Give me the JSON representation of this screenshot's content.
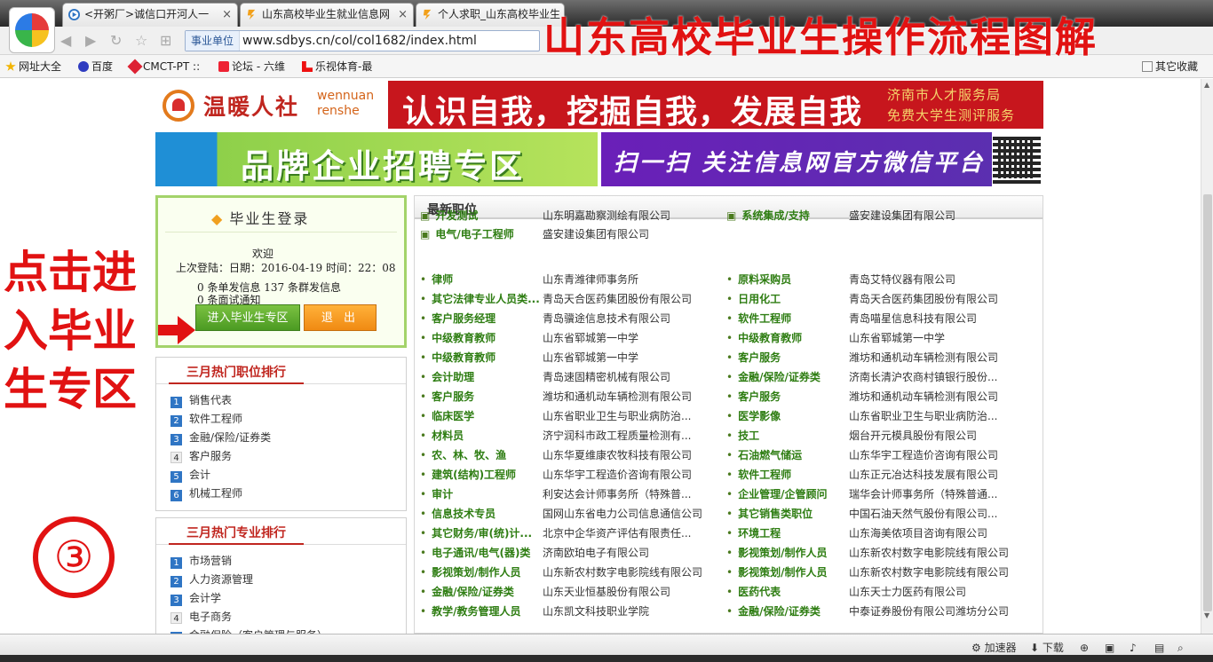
{
  "browser": {
    "tabs": [
      {
        "label": "<开粥厂>诚信口开河人一",
        "close": "×"
      },
      {
        "label": "山东高校毕业生就业信息网",
        "close": "×"
      },
      {
        "label": "个人求职_山东高校毕业生",
        "close": "×"
      }
    ],
    "address": {
      "chip": "事业单位",
      "url": "www.sdbys.cn/col/col1682/index.html"
    },
    "search_partial": "百度",
    "bookmarks": [
      "网址大全",
      "百度",
      "CMCT-PT ::",
      "论坛 - 六维",
      "乐视体育-最"
    ],
    "other_bookmarks": "其它收藏"
  },
  "overlay": {
    "title": "山东高校毕业生操作流程图解",
    "left_text": "点击进入毕业生专区",
    "step": "③"
  },
  "banners": {
    "wennuan_cn": "温暖人社",
    "wennuan_en1": "wennuan",
    "wennuan_en2": "renshe",
    "slogan": "认识自我，挖掘自我，发展自我",
    "service1": "济南市人才服务局",
    "service2": "免费大学生测评服务",
    "brand_zone": "品牌企业招聘专区",
    "wechat": "扫一扫  关注信息网官方微信平台"
  },
  "login": {
    "title": "毕业生登录",
    "welcome": "欢迎",
    "last_login": "上次登陆：日期：2016-04-19  时间：22：08",
    "single_msg": "0 条单发信息   137 条群发信息",
    "interview": "0 条面试通知",
    "enter_button": "进入毕业生专区",
    "quit_button": "退 出"
  },
  "hot_jobs": {
    "title": "三月热门职位排行",
    "items": [
      "销售代表",
      "软件工程师",
      "金融/保险/证券类",
      "客户服务",
      "会计",
      "机械工程师"
    ]
  },
  "hot_majors": {
    "title": "三月热门专业排行",
    "items": [
      "市场营销",
      "人力资源管理",
      "会计学",
      "电子商务",
      "金融保险（客户管理与服务）"
    ]
  },
  "jobs": {
    "title": "最新职位",
    "top_rows": [
      {
        "left_pos": "开发测试",
        "left_co": "山东明嘉勘察测绘有限公司",
        "right_pos": "系统集成/支持",
        "right_co": "盛安建设集团有限公司"
      },
      {
        "left_pos": "电气/电子工程师",
        "left_co": "盛安建设集团有限公司",
        "right_pos": "",
        "right_co": ""
      }
    ],
    "rows": [
      {
        "lp": "律师",
        "lc": "山东青潍律师事务所",
        "rp": "原料采购员",
        "rc": "青岛艾特仪器有限公司"
      },
      {
        "lp": "其它法律专业人员类...",
        "lc": "青岛天合医药集团股份有限公司",
        "rp": "日用化工",
        "rc": "青岛天合医药集团股份有限公司"
      },
      {
        "lp": "客户服务经理",
        "lc": "青岛骥途信息技术有限公司",
        "rp": "软件工程师",
        "rc": "青岛喵星信息科技有限公司"
      },
      {
        "lp": "中级教育教师",
        "lc": "山东省郓城第一中学",
        "rp": "中级教育教师",
        "rc": "山东省郓城第一中学"
      },
      {
        "lp": "中级教育教师",
        "lc": "山东省郓城第一中学",
        "rp": "客户服务",
        "rc": "潍坊和通机动车辆检测有限公司"
      },
      {
        "lp": "会计助理",
        "lc": "青岛速固精密机械有限公司",
        "rp": "金融/保险/证券类",
        "rc": "济南长清沪农商村镇银行股份..."
      },
      {
        "lp": "客户服务",
        "lc": "潍坊和通机动车辆检测有限公司",
        "rp": "客户服务",
        "rc": "潍坊和通机动车辆检测有限公司"
      },
      {
        "lp": "临床医学",
        "lc": "山东省职业卫生与职业病防治...",
        "rp": "医学影像",
        "rc": "山东省职业卫生与职业病防治..."
      },
      {
        "lp": "材料员",
        "lc": "济宁润科市政工程质量检测有...",
        "rp": "技工",
        "rc": "烟台开元模具股份有限公司"
      },
      {
        "lp": "农、林、牧、渔",
        "lc": "山东华夏维康农牧科技有限公司",
        "rp": "石油燃气储运",
        "rc": "山东华宇工程造价咨询有限公司"
      },
      {
        "lp": "建筑(结构)工程师",
        "lc": "山东华宇工程造价咨询有限公司",
        "rp": "软件工程师",
        "rc": "山东正元冶达科技发展有限公司"
      },
      {
        "lp": "审计",
        "lc": "利安达会计师事务所（特殊普...",
        "rp": "企业管理/企管顾问",
        "rc": "瑞华会计师事务所（特殊普通..."
      },
      {
        "lp": "信息技术专员",
        "lc": "国网山东省电力公司信息通信公司",
        "rp": "其它销售类职位",
        "rc": "中国石油天然气股份有限公司..."
      },
      {
        "lp": "其它财务/审(统)计...",
        "lc": "北京中企华资产评估有限责任...",
        "rp": "环境工程",
        "rc": "山东海美侬项目咨询有限公司"
      },
      {
        "lp": "电子通讯/电气(器)类",
        "lc": "济南欧珀电子有限公司",
        "rp": "影视策划/制作人员",
        "rc": "山东新农村数字电影院线有限公司"
      },
      {
        "lp": "影视策划/制作人员",
        "lc": "山东新农村数字电影院线有限公司",
        "rp": "影视策划/制作人员",
        "rc": "山东新农村数字电影院线有限公司"
      },
      {
        "lp": "金融/保险/证券类",
        "lc": "山东天业恒基股份有限公司",
        "rp": "医药代表",
        "rc": "山东天士力医药有限公司"
      },
      {
        "lp": "教学/教务管理人员",
        "lc": "山东凯文科技职业学院",
        "rp": "金融/保险/证券类",
        "rc": "中泰证券股份有限公司潍坊分公司"
      }
    ]
  },
  "status": {
    "accelerator": "加速器",
    "download": "下载"
  },
  "colors": {
    "accent_red": "#e11212",
    "job_green": "#2e7d12"
  }
}
